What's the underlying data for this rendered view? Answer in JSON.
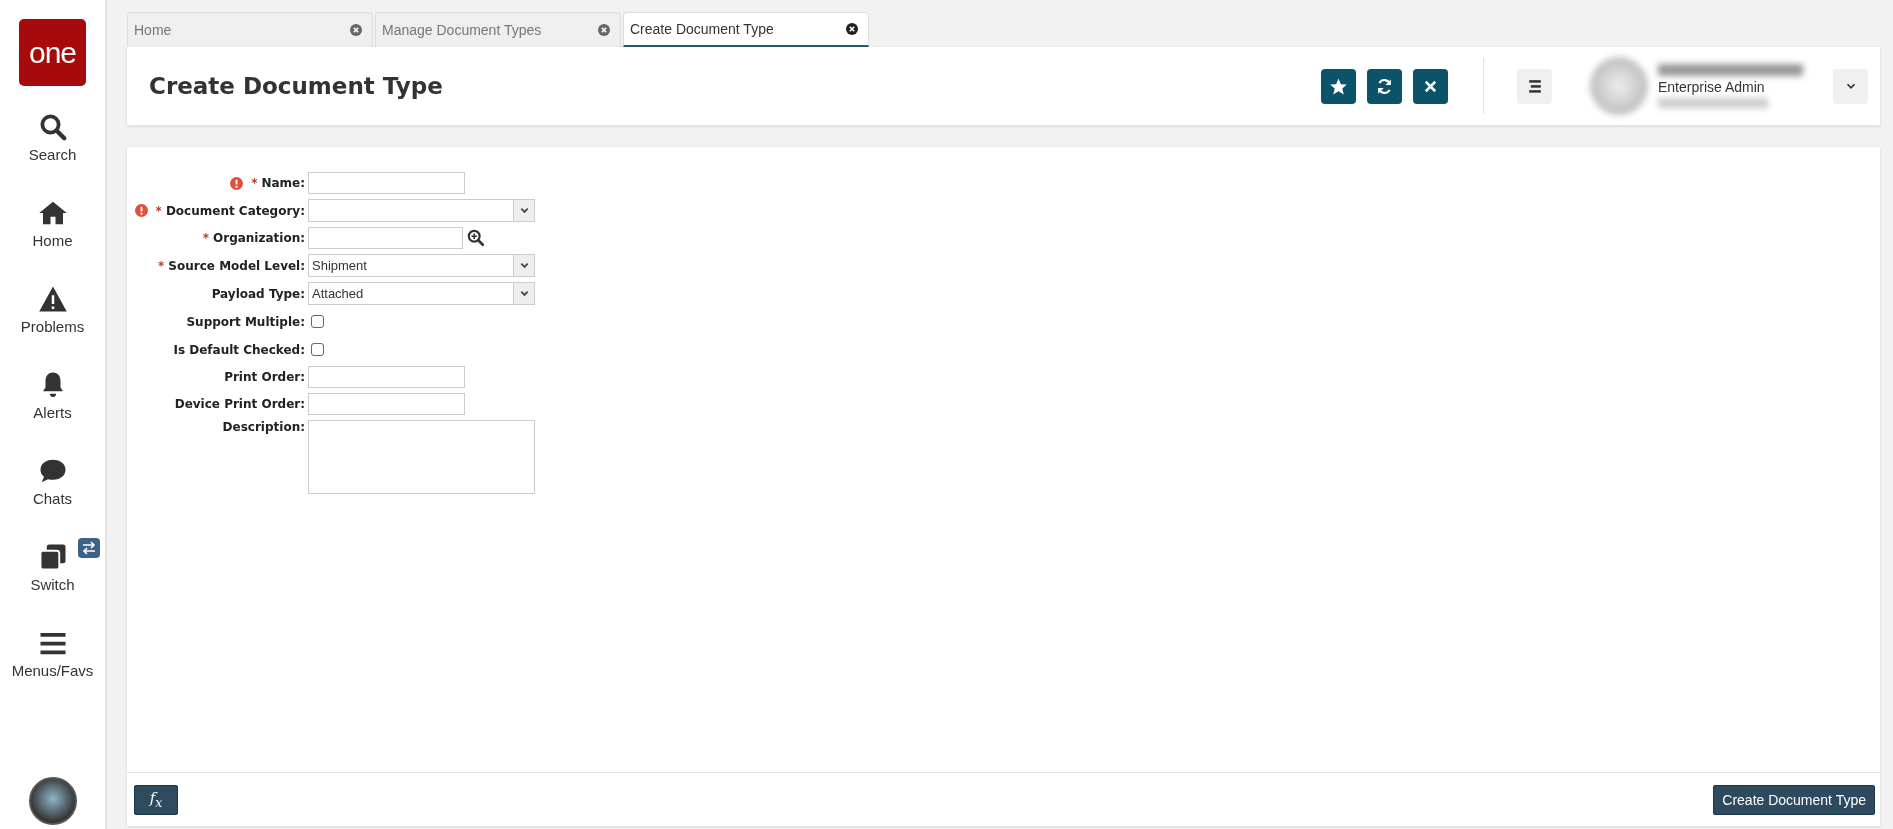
{
  "logo": {
    "text": "one"
  },
  "sidebar": {
    "items": [
      {
        "label": "Search"
      },
      {
        "label": "Home"
      },
      {
        "label": "Problems"
      },
      {
        "label": "Alerts"
      },
      {
        "label": "Chats"
      },
      {
        "label": "Switch"
      },
      {
        "label": "Menus/Favs"
      }
    ]
  },
  "tabs": [
    {
      "label": "Home",
      "selected": false
    },
    {
      "label": "Manage Document Types",
      "selected": false
    },
    {
      "label": "Create Document Type",
      "selected": true
    }
  ],
  "header": {
    "title": "Create Document Type",
    "user_role": "Enterprise Admin"
  },
  "form": {
    "fields": [
      {
        "label": "Name:",
        "kind": "text",
        "required_marker": "*",
        "error": true
      },
      {
        "label": "Document Category:",
        "kind": "select",
        "required_marker": "*",
        "error": true
      },
      {
        "label": "Organization:",
        "kind": "lookup",
        "required_marker": "*",
        "error": false
      },
      {
        "label": "Source Model Level:",
        "kind": "select",
        "required_marker": "*",
        "error": false,
        "value": "Shipment"
      },
      {
        "label": "Payload Type:",
        "kind": "select",
        "error": false,
        "value": "Attached"
      },
      {
        "label": "Support Multiple:",
        "kind": "checkbox",
        "error": false,
        "checked": false
      },
      {
        "label": "Is Default Checked:",
        "kind": "checkbox",
        "error": false,
        "checked": false
      },
      {
        "label": "Print Order:",
        "kind": "text",
        "error": false
      },
      {
        "label": "Device Print Order:",
        "kind": "text",
        "error": false
      },
      {
        "label": "Description:",
        "kind": "textarea",
        "error": false
      }
    ]
  },
  "footer": {
    "formula_button": "f$_{x}$",
    "submit_button": "Create Document Type"
  }
}
